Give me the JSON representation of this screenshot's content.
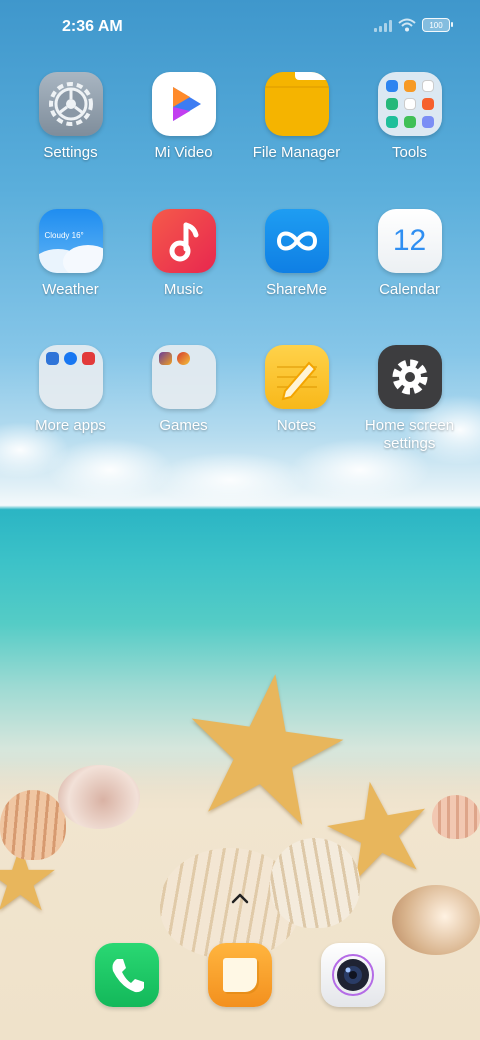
{
  "status": {
    "time": "2:36 AM",
    "battery": "100",
    "icons": [
      "signal-icon",
      "wifi-icon",
      "battery-icon"
    ]
  },
  "apps": {
    "settings": "Settings",
    "mi_video": "Mi Video",
    "file_manager": "File Manager",
    "tools": "Tools",
    "weather": "Weather",
    "weather_widget": "Cloudy 16°",
    "music": "Music",
    "shareme": "ShareMe",
    "calendar": "Calendar",
    "calendar_day": "12",
    "more_apps": "More apps",
    "games": "Games",
    "notes": "Notes",
    "home_screen_settings": "Home screen settings"
  },
  "dock": [
    "phone-icon",
    "messages-icon",
    "camera-icon"
  ],
  "colors": {
    "phone": "#21c867",
    "messages": "#f7a12c",
    "file_manager": "#f5b400",
    "shareme": "#1a8ef0",
    "music": "#f0414a",
    "notes": "#f8c22e",
    "home_settings": "#3e3e3e"
  }
}
